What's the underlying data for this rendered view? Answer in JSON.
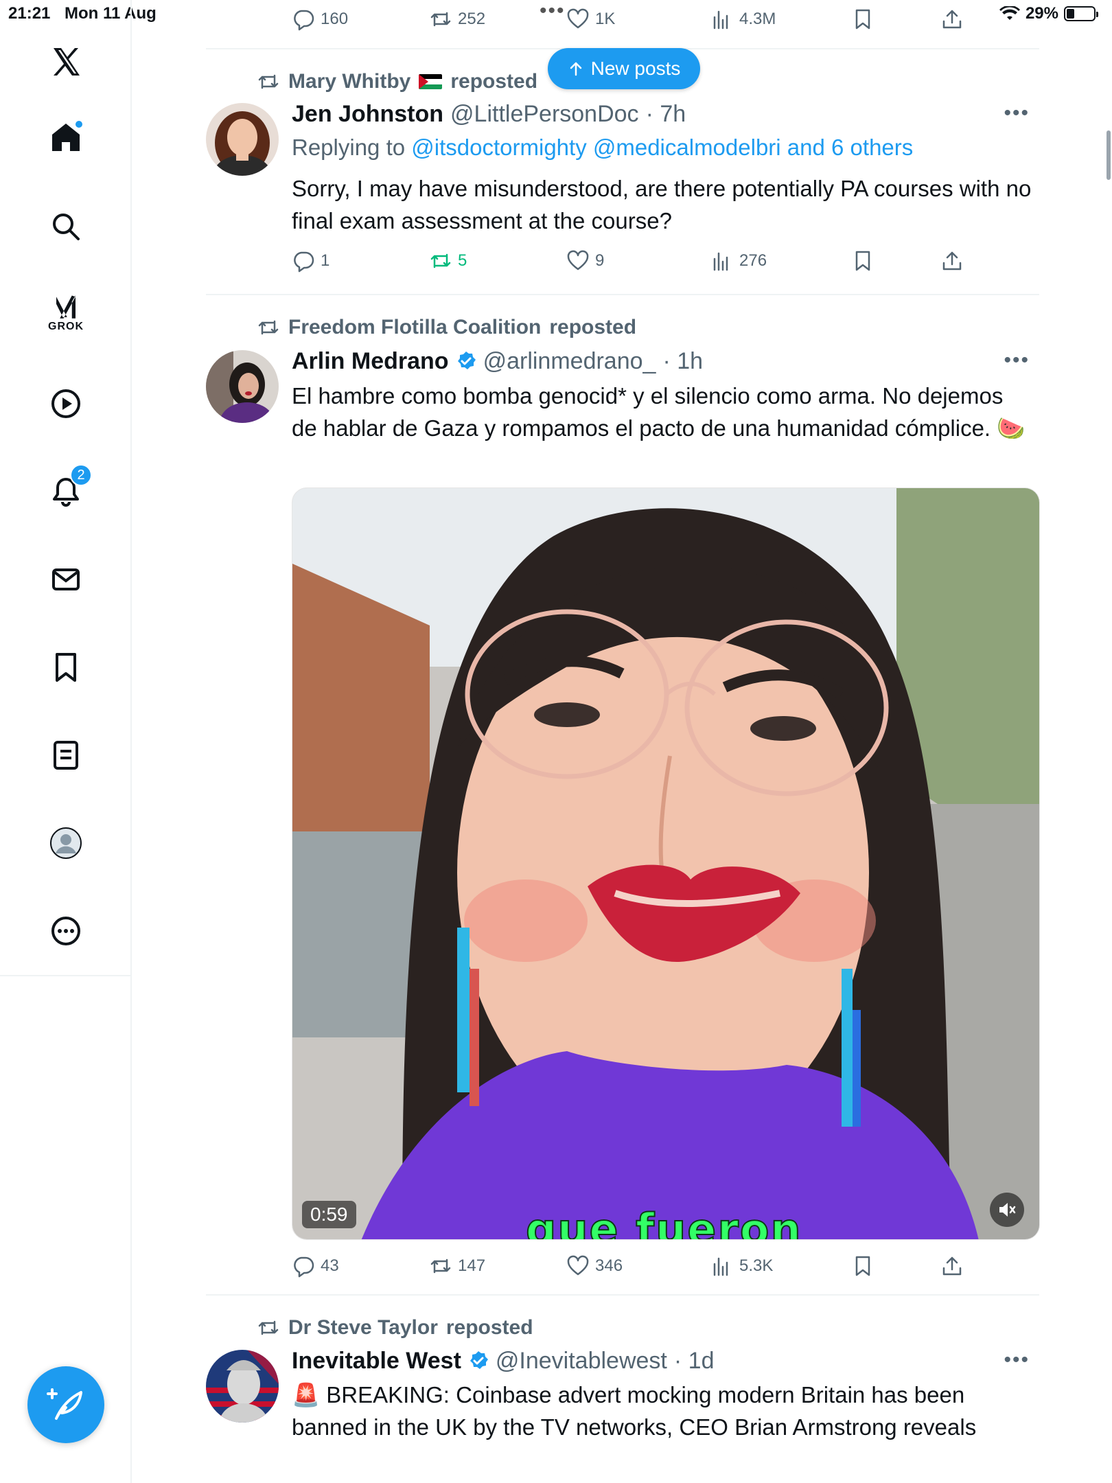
{
  "status_bar": {
    "time": "21:21",
    "date": "Mon 11 Aug",
    "battery": "29%",
    "battery_level": 0.29
  },
  "sidebar": {
    "grok_label": "GROK",
    "notifications_badge": "2"
  },
  "compose_button": {
    "icon": "compose-feather-plus-icon"
  },
  "new_posts": {
    "label": "New posts"
  },
  "top_actions": {
    "replies": "160",
    "reposts": "252",
    "likes": "1K",
    "views": "4.3M"
  },
  "tweets": [
    {
      "reposted_by": "Mary Whitby",
      "reposted_suffix": "reposted",
      "name": "Jen Johnston",
      "handle": "@LittlePersonDoc",
      "time": "· 7h",
      "replying_prefix": "Replying to",
      "replying_to": "@itsdoctormighty @medicalmodelbri and 6 others",
      "text": "Sorry, I may have misunderstood, are there potentially PA courses with no final exam assessment at the course?",
      "replies": "1",
      "reposts": "5",
      "likes": "9",
      "views": "276"
    },
    {
      "reposted_by": "Freedom Flotilla Coalition",
      "reposted_suffix": "reposted",
      "name": "Arlin Medrano",
      "handle": "@arlinmedrano_",
      "time": "· 1h",
      "text": "El hambre como bomba genocid* y el silencio como arma. No dejemos de hablar de Gaza y rompamos el pacto de una humanidad cómplice. 🍉",
      "video_duration": "0:59",
      "video_caption": "que fueron",
      "replies": "43",
      "reposts": "147",
      "likes": "346",
      "views": "5.3K"
    },
    {
      "reposted_by": "Dr Steve Taylor",
      "reposted_suffix": "reposted",
      "name": "Inevitable West",
      "handle": "@Inevitablewest",
      "time": "· 1d",
      "text": "🚨 BREAKING: Coinbase advert mocking modern Britain has been banned in the UK by the TV networks, CEO Brian Armstrong reveals"
    }
  ],
  "colors": {
    "accent": "#1d9bf0",
    "repost_green": "#00ba7c",
    "muted": "#536471",
    "text": "#0f1419"
  }
}
